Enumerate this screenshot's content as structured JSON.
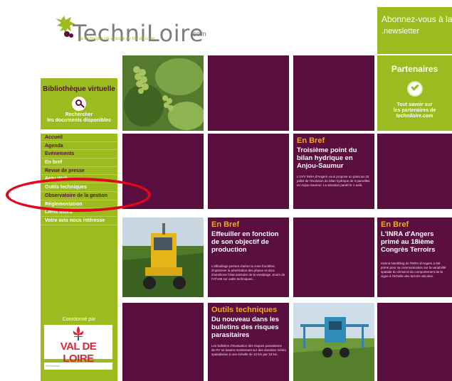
{
  "header": {
    "logo_text": "TechniLoire",
    "logo_suffix": ".com",
    "tagline": "La technique viti-vinicole du Val de Loire",
    "newsletter_line1": "Abonnez-vous à la",
    "newsletter_line2": ".newsletter"
  },
  "sidebar": {
    "library_title": "Bibliothèque virtuelle",
    "library_search": "Rechercher\nles documents disponibles",
    "menu": [
      {
        "label": "Accueil"
      },
      {
        "label": "Agenda"
      },
      {
        "label": "Evénements"
      },
      {
        "label": "En bref"
      },
      {
        "label": "Revue de presse"
      },
      {
        "label": "Actu Web"
      },
      {
        "label": "Outils techniques"
      },
      {
        "label": "Observatoire de la gestion"
      },
      {
        "label": "Réglementation"
      },
      {
        "label": "Liens utiles"
      },
      {
        "label": "Votre avis nous intéresse"
      }
    ],
    "coordinated_by": "Coordonné par",
    "region_logo_text": "VAL DE LOIRE",
    "search_placeholder": "Rechercher"
  },
  "partners": {
    "title": "Partenaires",
    "text": "Tout savoir sur\nles partenaires de\ntechniloire.com"
  },
  "tiles": {
    "t1": {
      "category": "En Bref",
      "headline": "Troisième point du bilan hydrique en Anjou-Saumur",
      "body": "L'UVV INRA d'Angers vous propose un point au 15 juillet de l'évolution du bilan hydrique de 3 parcelles en Anjou-Saumur. La situation paraît le 1 août."
    },
    "t2": {
      "category": "En Bref",
      "headline": "Effeuiller en fonction de son objectif de production",
      "body": "L'effeuillage permet d'aérer la zone fructifère, d'optimiser la pénétration des phytos et donc d'améliorer l'état sanitaire de la vendange. Zoom de l'ATV49 sur outils techniques..."
    },
    "t3": {
      "category": "En Bref",
      "headline": "L'INRA d'Angers primé au 18ième Congrès Terroirs",
      "body": "Hanna Neethling de l'INRA d'Angers a été primé pour sa communication sur la variabilité spatiale du climat et du comportement de la vigne à l'échelle des terroirs viticoles."
    },
    "t4": {
      "category": "Outils techniques",
      "headline": "Du nouveau dans les bulletins des risques parasitaires",
      "body": "Les bulletins d'évaluation des risques parasitaires de RV se basent maintenant sur des données météo spatialisées à une échelle de 10 km par 10 km."
    }
  },
  "colors": {
    "plum": "#5a0f3f",
    "lime": "#9bbb1e",
    "orange": "#f7a81b",
    "annotation_red": "#e3061a"
  }
}
